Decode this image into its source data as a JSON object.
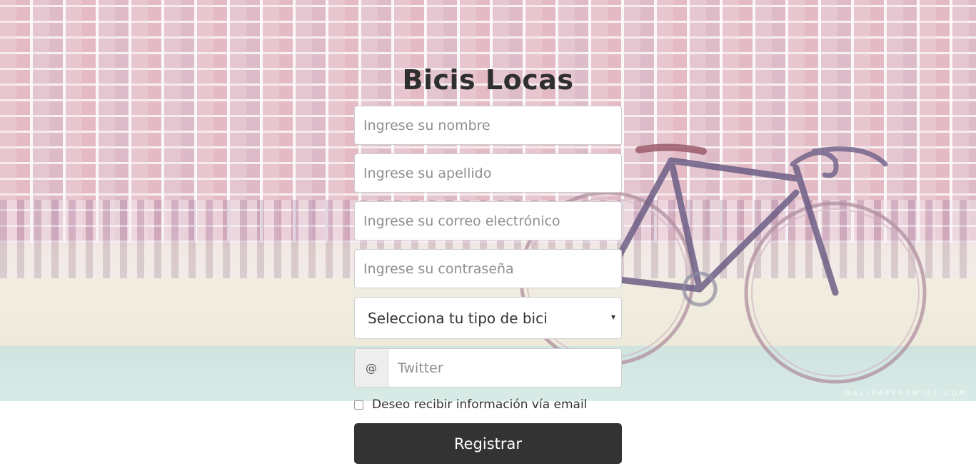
{
  "page": {
    "title": "Bicis Locas",
    "watermark": "WALLPAPERSWIDE.COM"
  },
  "form": {
    "fields": [
      {
        "placeholder": "Ingrese su nombre"
      },
      {
        "placeholder": "Ingrese su apellido"
      },
      {
        "placeholder": "Ingrese su correo electrónico"
      },
      {
        "placeholder": "Ingrese su contraseña"
      }
    ],
    "bike_select": {
      "selected": "Selecciona tu tipo de bici",
      "caret": "▾"
    },
    "twitter": {
      "addon": "@",
      "placeholder": "Twitter"
    },
    "newsletter_label": "Deseo recibir información vía email",
    "submit_label": "Registrar"
  },
  "colors": {
    "button_bg": "#333333",
    "button_text": "#ffffff",
    "title": "#2f2f2f"
  }
}
